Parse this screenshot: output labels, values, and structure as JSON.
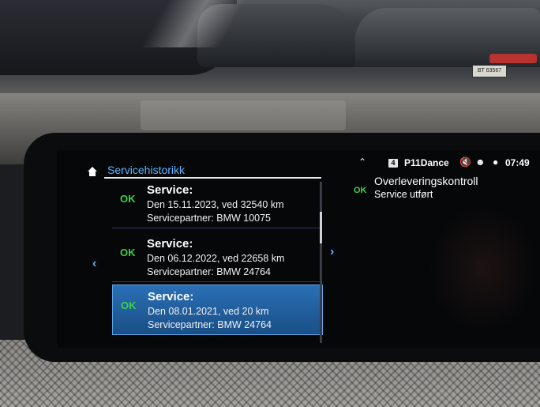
{
  "statusbar": {
    "up_icon": "chevron-up-icon",
    "profile_number": "4",
    "profile_name": "P11Dance",
    "time": "07:49"
  },
  "background": {
    "license_plate": "BT 63567"
  },
  "left_panel": {
    "title": "Servicehistorikk",
    "items": [
      {
        "status": "OK",
        "title": "Service:",
        "date_line": "Den 15.11.2023, ved 32540 km",
        "partner_line": "Servicepartner: BMW 10075"
      },
      {
        "status": "OK",
        "title": "Service:",
        "date_line": "Den 06.12.2022, ved 22658 km",
        "partner_line": "Servicepartner: BMW 24764"
      },
      {
        "status": "OK",
        "title": "Service:",
        "date_line": "Den 08.01.2021, ved 20 km",
        "partner_line": "Servicepartner: BMW 24764"
      }
    ],
    "selected_index": 2
  },
  "right_panel": {
    "status": "OK",
    "title": "Overleveringskontroll",
    "subtitle": "Service utført"
  },
  "colors": {
    "accent_blue": "#5fb3ff",
    "ok_green": "#3bd24a",
    "selected_row": "#2a6fb5"
  }
}
